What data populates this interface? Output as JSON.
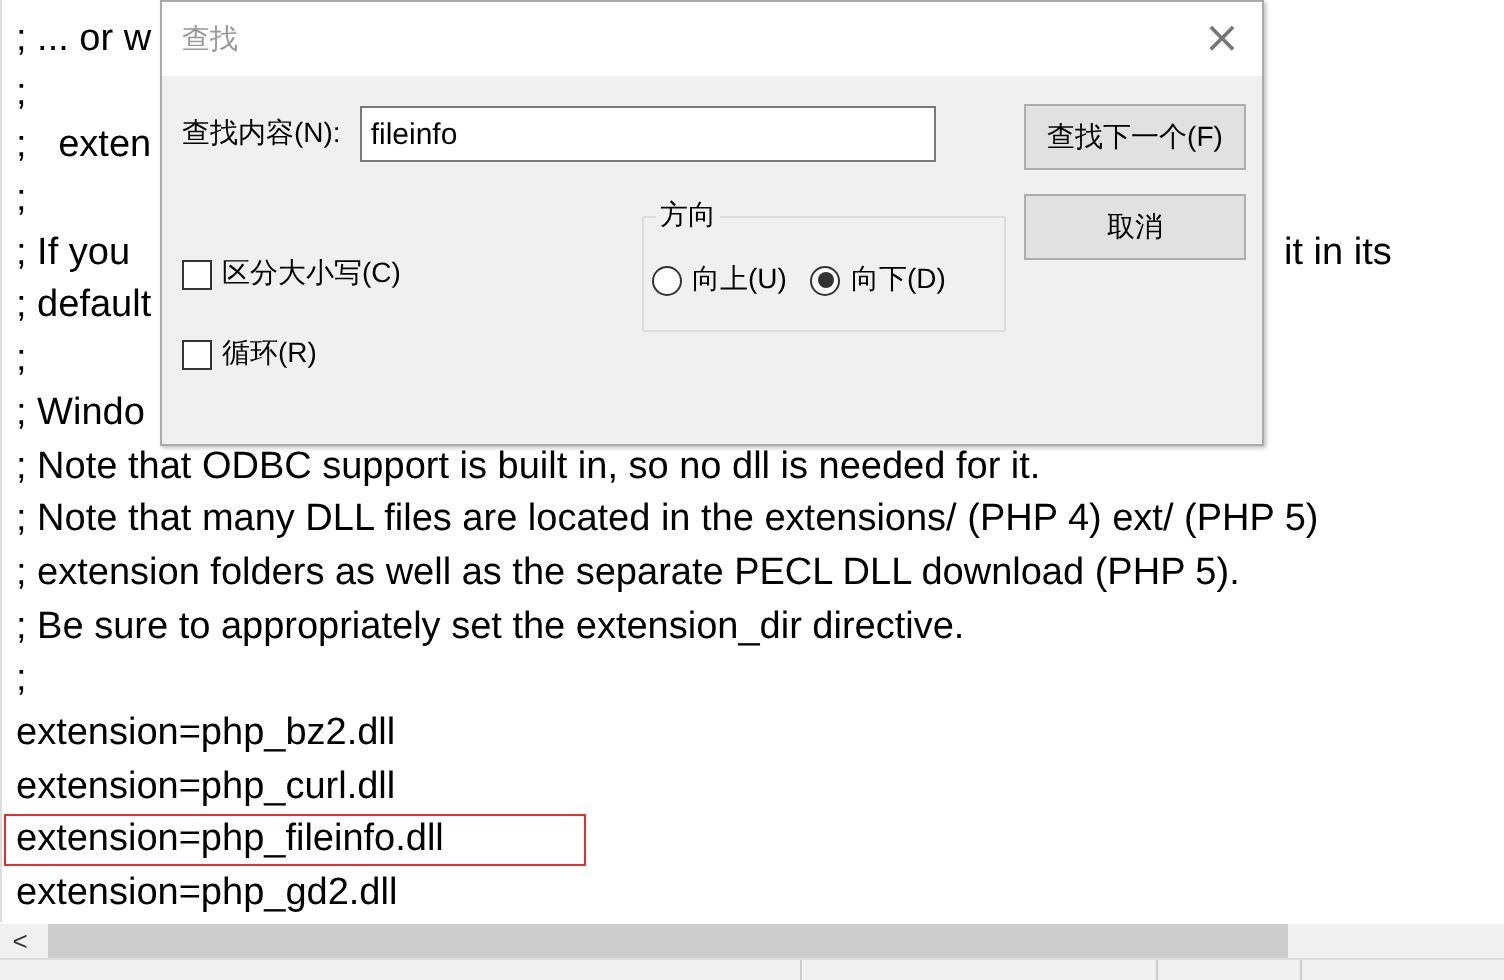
{
  "editor": {
    "lines": [
      {
        "text": "; ... or w",
        "highlighted": false
      },
      {
        "text": ";",
        "highlighted": false
      },
      {
        "text": ";   exten",
        "highlighted": false
      },
      {
        "text": ";",
        "highlighted": false
      },
      {
        "text": "; If you",
        "tail": "it in its",
        "highlighted": false
      },
      {
        "text": "; default",
        "highlighted": false
      },
      {
        "text": ";",
        "highlighted": false
      },
      {
        "text": "; Windo",
        "highlighted": false
      },
      {
        "text": "; Note that ODBC support is built in, so no dll is needed for it.",
        "highlighted": false
      },
      {
        "text": "; Note that many DLL files are located in the extensions/ (PHP 4) ext/ (PHP 5)",
        "highlighted": false
      },
      {
        "text": "; extension folders as well as the separate PECL DLL download (PHP 5).",
        "highlighted": false
      },
      {
        "text": "; Be sure to appropriately set the extension_dir directive.",
        "highlighted": false
      },
      {
        "text": ";",
        "highlighted": false
      },
      {
        "text": "extension=php_bz2.dll",
        "highlighted": false
      },
      {
        "text": "extension=php_curl.dll",
        "highlighted": false
      },
      {
        "text": "extension=php_fileinfo.dll",
        "highlighted": true
      },
      {
        "text": "extension=php_gd2.dll",
        "highlighted": false
      }
    ]
  },
  "scroll_left_arrow": "<",
  "find_dialog": {
    "title": "查找",
    "close": "×",
    "find_label": "查找内容(N):",
    "find_value": "fileinfo",
    "buttons": [
      "查找下一个(F)",
      "取消"
    ],
    "direction": {
      "label": "方向",
      "options": [
        {
          "label": "向上(U)",
          "selected": false
        },
        {
          "label": "向下(D)",
          "selected": true
        }
      ]
    },
    "checkboxes": [
      {
        "label": "区分大小写(C)",
        "checked": false
      },
      {
        "label": "循环(R)",
        "checked": false
      }
    ]
  }
}
